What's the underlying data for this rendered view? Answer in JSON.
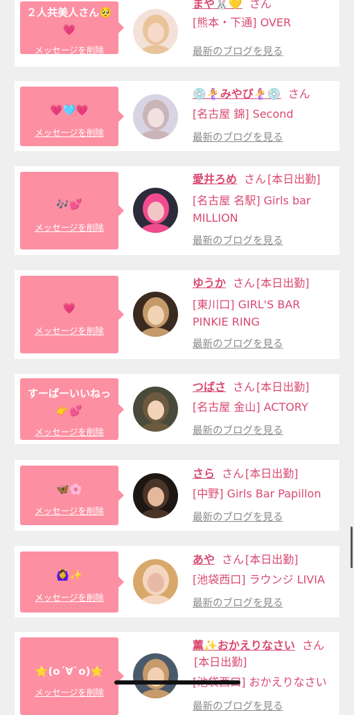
{
  "delete_label": "メッセージを削除",
  "blog_label": "最新のブログを見る",
  "honorific": "さん",
  "colors": {
    "accent_pink": "#fd8fa2",
    "name_pink": "#d94a72",
    "link_gray": "#8a8a8a",
    "page_bg": "#efefef"
  },
  "items": [
    {
      "message": "２人共美人さん🥺\n💗",
      "name": "まや🐰💛",
      "status": "",
      "shop": "[熊本・下通] OVER",
      "avatar_icon": "girl-photo-icon"
    },
    {
      "message": "💗🩵💗",
      "name": "💿🧜‍♀️みやび🧜‍♀️💿",
      "status": "",
      "shop": "[名古屋 錦] Second",
      "avatar_icon": "girl-photo-icon"
    },
    {
      "message": "🎶💕",
      "name": "愛井ろめ",
      "status": "[本日出勤]",
      "shop": "[名古屋 名駅] Girls bar\nMILLION",
      "avatar_icon": "girl-photo-icon"
    },
    {
      "message": "💗",
      "name": "ゆうか",
      "status": "[本日出勤]",
      "shop": "[東川口] GIRL'S BAR\nPINKIE RING",
      "avatar_icon": "girl-photo-icon"
    },
    {
      "message": "すーぱーいいねっ\n👉💕",
      "name": "つばさ",
      "status": "[本日出勤]",
      "shop": "[名古屋 金山] ACTORY",
      "avatar_icon": "girl-photo-icon"
    },
    {
      "message": "🦋🌸",
      "name": "さら",
      "status": "[本日出勤]",
      "shop": "[中野] Girls Bar Papillon",
      "avatar_icon": "girl-photo-icon"
    },
    {
      "message": "🙆‍♀️✨",
      "name": "あや",
      "status": "[本日出勤]",
      "shop": "[池袋西口] ラウンジ LIVIA",
      "avatar_icon": "girl-photo-icon"
    },
    {
      "message": "⭐️(o´∀`o)⭐️",
      "name": "薫✨おかえりなさい",
      "status": "[本日出勤]",
      "shop": "[池袋西口] おかえりなさい",
      "avatar_icon": "girl-photo-icon"
    }
  ]
}
